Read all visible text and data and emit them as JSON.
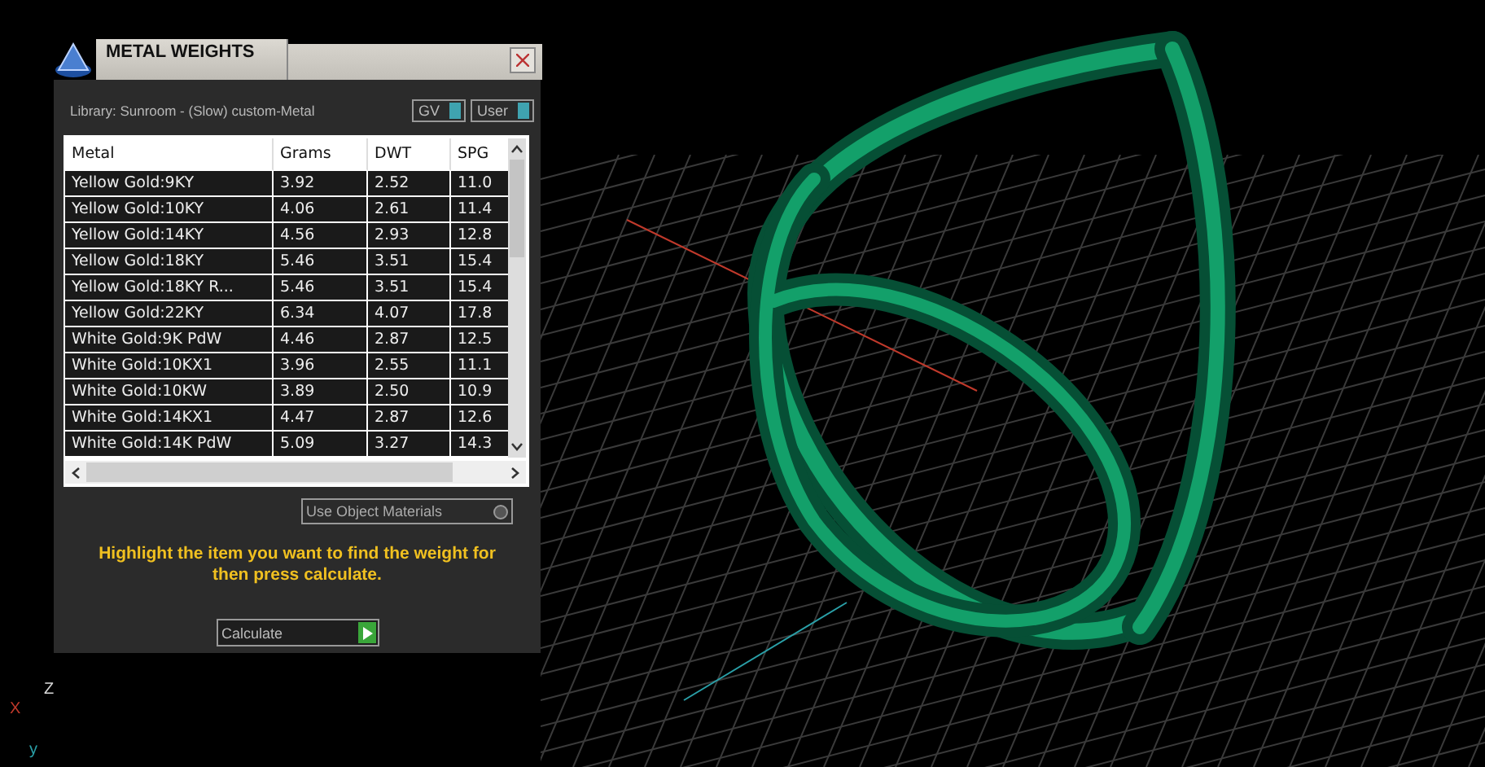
{
  "panel": {
    "title": "METAL WEIGHTS",
    "library": "Library: Sunroom - (Slow) custom-Metal",
    "toggles": [
      {
        "label": "GV",
        "on": true
      },
      {
        "label": "User",
        "on": true
      }
    ],
    "table": {
      "columns": [
        "Metal",
        "Grams",
        "DWT",
        "SPG"
      ],
      "rows": [
        [
          "Yellow Gold:9KY",
          "3.92",
          "2.52",
          "11.0"
        ],
        [
          "Yellow Gold:10KY",
          "4.06",
          "2.61",
          "11.4"
        ],
        [
          "Yellow Gold:14KY",
          "4.56",
          "2.93",
          "12.8"
        ],
        [
          "Yellow Gold:18KY",
          "5.46",
          "3.51",
          "15.4"
        ],
        [
          "Yellow Gold:18KY R...",
          "5.46",
          "3.51",
          "15.4"
        ],
        [
          "Yellow Gold:22KY",
          "6.34",
          "4.07",
          "17.8"
        ],
        [
          "White Gold:9K PdW",
          "4.46",
          "2.87",
          "12.5"
        ],
        [
          "White Gold:10KX1",
          "3.96",
          "2.55",
          "11.1"
        ],
        [
          "White Gold:10KW",
          "3.89",
          "2.50",
          "10.9"
        ],
        [
          "White Gold:14KX1",
          "4.47",
          "2.87",
          "12.6"
        ],
        [
          "White Gold:14K PdW",
          "5.09",
          "3.27",
          "14.3"
        ]
      ]
    },
    "use_object_materials": {
      "label": "Use Object Materials",
      "on": false
    },
    "message": "Highlight the item you want to find the weight for then press calculate.",
    "calculate_button": "Calculate"
  },
  "viewport": {
    "axes": [
      {
        "label": "X",
        "kind": "x"
      },
      {
        "label": "y",
        "kind": "y"
      },
      {
        "label": "Z",
        "kind": "z"
      }
    ]
  }
}
